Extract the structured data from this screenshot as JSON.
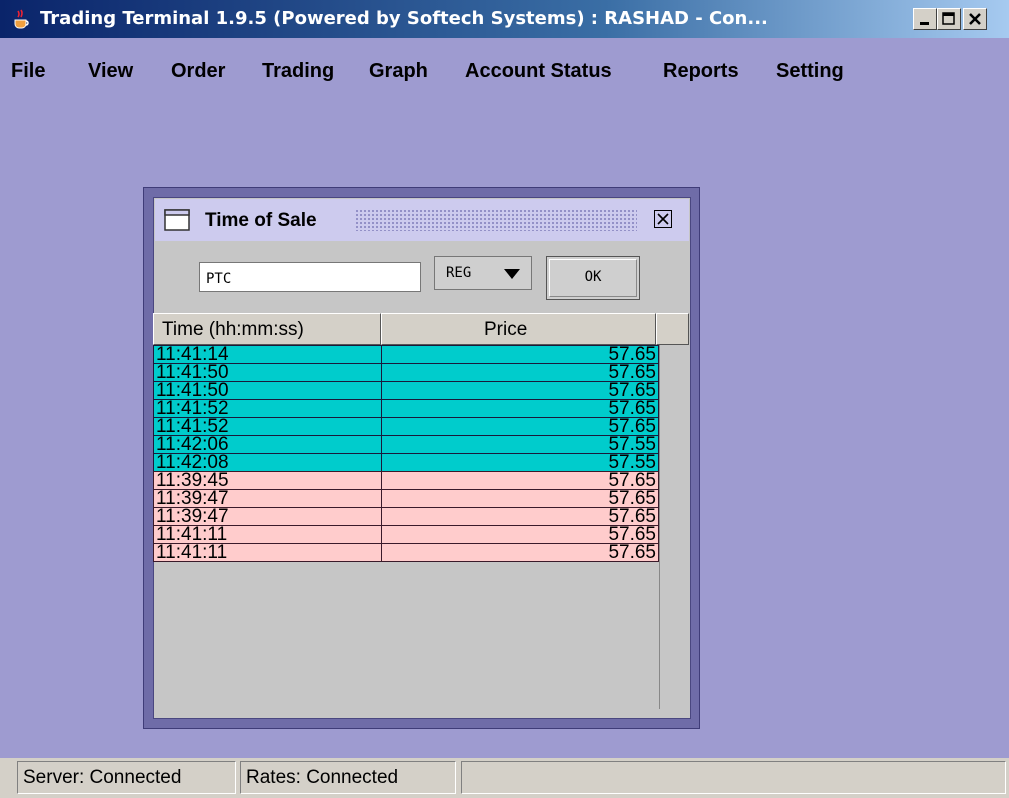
{
  "window": {
    "title": "Trading Terminal 1.9.5 (Powered by Softech Systems)  :  RASHAD - Con...",
    "app_icon": "java-cup-icon"
  },
  "menu": [
    "File",
    "View",
    "Order",
    "Trading",
    "Graph",
    "Account Status",
    "Reports",
    "Setting"
  ],
  "dialog": {
    "title": "Time of Sale",
    "symbol_value": "PTC",
    "market_select": "REG",
    "ok_label": "OK",
    "columns": [
      "Time (hh:mm:ss)",
      "Price"
    ],
    "rows": [
      {
        "time": "11:41:14",
        "price": "57.65",
        "side": "buy"
      },
      {
        "time": "11:41:50",
        "price": "57.65",
        "side": "buy"
      },
      {
        "time": "11:41:50",
        "price": "57.65",
        "side": "buy"
      },
      {
        "time": "11:41:52",
        "price": "57.65",
        "side": "buy"
      },
      {
        "time": "11:41:52",
        "price": "57.65",
        "side": "buy"
      },
      {
        "time": "11:42:06",
        "price": "57.55",
        "side": "buy"
      },
      {
        "time": "11:42:08",
        "price": "57.55",
        "side": "buy"
      },
      {
        "time": "11:39:45",
        "price": "57.65",
        "side": "sell"
      },
      {
        "time": "11:39:47",
        "price": "57.65",
        "side": "sell"
      },
      {
        "time": "11:39:47",
        "price": "57.65",
        "side": "sell"
      },
      {
        "time": "11:41:11",
        "price": "57.65",
        "side": "sell"
      },
      {
        "time": "11:41:11",
        "price": "57.65",
        "side": "sell"
      }
    ]
  },
  "status": {
    "server": "Server: Connected",
    "rates": "Rates: Connected",
    "extra": ""
  },
  "colors": {
    "desktop": "#9e9bd0",
    "buy_row": "#00cccc",
    "sell_row": "#ffcccc",
    "titlebar": "#0a246a"
  }
}
